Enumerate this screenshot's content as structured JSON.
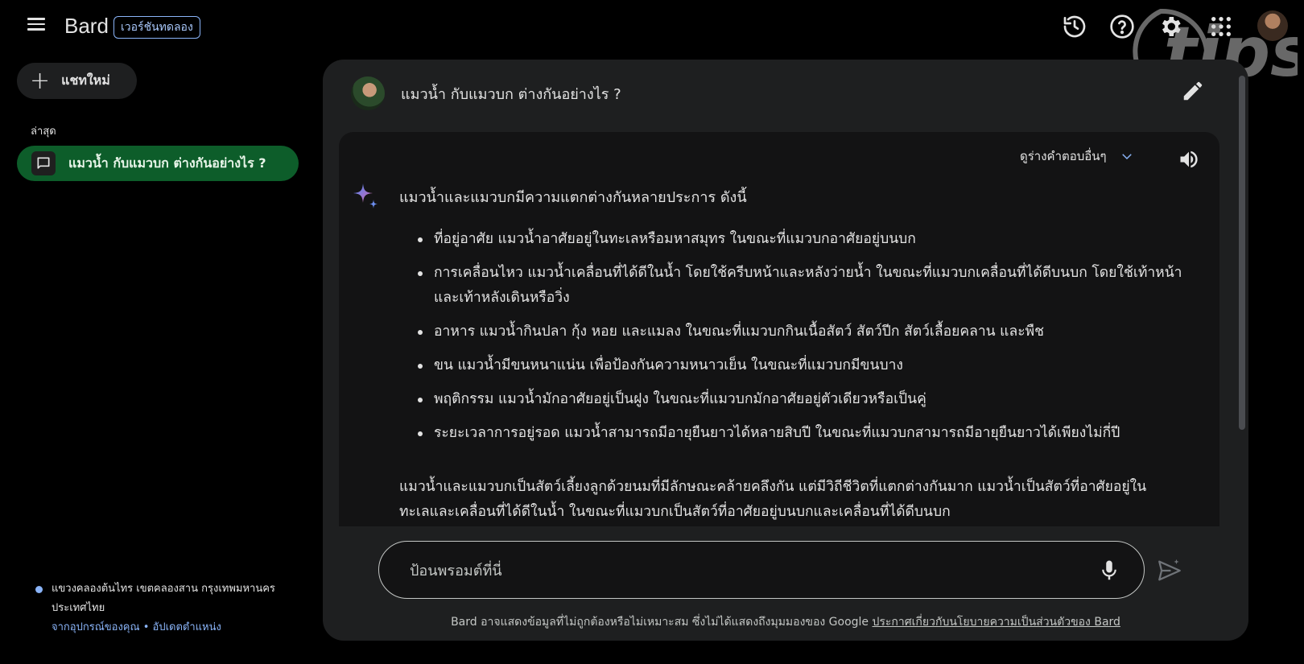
{
  "header": {
    "app_name": "Bard",
    "badge": "เวอร์ชันทดลอง",
    "icons": [
      "history-icon",
      "help-icon",
      "settings-icon",
      "apps-grid-icon",
      "account-avatar"
    ],
    "watermark_text": "tips"
  },
  "sidebar": {
    "new_chat_label": "แชทใหม่",
    "recent_title": "ล่าสุด",
    "recent_items": [
      {
        "label": "แมวน้ำ กับแมวบก ต่างกันอย่างไร ?",
        "active": true
      }
    ],
    "location": {
      "text": "แขวงคลองต้นไทร เขตคลองสาน กรุงเทพมหานคร ประเทศไทย",
      "source": "จากอุปกรณ์ของคุณ",
      "separator": "•",
      "update_link": "อัปเดตตำแหน่ง"
    }
  },
  "conversation": {
    "user_prompt": "แมวน้ำ กับแมวบก ต่างกันอย่างไร ?",
    "drafts_label": "ดูร่างคำตอบอื่นๆ",
    "response": {
      "intro": "แมวน้ำและแมวบกมีความแตกต่างกันหลายประการ ดังนี้",
      "bullets": [
        "ที่อยู่อาศัย แมวน้ำอาศัยอยู่ในทะเลหรือมหาสมุทร ในขณะที่แมวบกอาศัยอยู่บนบก",
        "การเคลื่อนไหว แมวน้ำเคลื่อนที่ได้ดีในน้ำ โดยใช้ครีบหน้าและหลังว่ายน้ำ ในขณะที่แมวบกเคลื่อนที่ได้ดีบนบก โดยใช้เท้าหน้าและเท้าหลังเดินหรือวิ่ง",
        "อาหาร แมวน้ำกินปลา กุ้ง หอย และแมลง ในขณะที่แมวบกกินเนื้อสัตว์ สัตว์ปีก สัตว์เลื้อยคลาน และพืช",
        "ขน แมวน้ำมีขนหนาแน่น เพื่อป้องกันความหนาวเย็น ในขณะที่แมวบกมีขนบาง",
        "พฤติกรรม แมวน้ำมักอาศัยอยู่เป็นฝูง ในขณะที่แมวบกมักอาศัยอยู่ตัวเดียวหรือเป็นคู่",
        "ระยะเวลาการอยู่รอด แมวน้ำสามารถมีอายุยืนยาวได้หลายสิบปี ในขณะที่แมวบกสามารถมีอายุยืนยาวได้เพียงไม่กี่ปี"
      ],
      "summary": "แมวน้ำและแมวบกเป็นสัตว์เลี้ยงลูกด้วยนมที่มีลักษณะคล้ายคลึงกัน แต่มีวิถีชีวิตที่แตกต่างกันมาก แมวน้ำเป็นสัตว์ที่อาศัยอยู่ในทะเลและเคลื่อนที่ได้ดีในน้ำ ในขณะที่แมวบกเป็นสัตว์ที่อาศัยอยู่บนบกและเคลื่อนที่ได้ดีบนบก"
    }
  },
  "composer": {
    "placeholder": "ป้อนพรอมต์ที่นี่",
    "value": "",
    "disclaimer": "Bard อาจแสดงข้อมูลที่ไม่ถูกต้องหรือไม่เหมาะสม ซึ่งไม่ได้แสดงถึงมุมมองของ Google",
    "privacy_link": "ประกาศเกี่ยวกับนโยบายความเป็นส่วนตัวของ Bard"
  },
  "colors": {
    "background": "#000000",
    "panel": "#1e1f20",
    "answer_bg": "#131314",
    "active_chat": "#0d5d2a",
    "accent_blue": "#8ab4f8"
  }
}
